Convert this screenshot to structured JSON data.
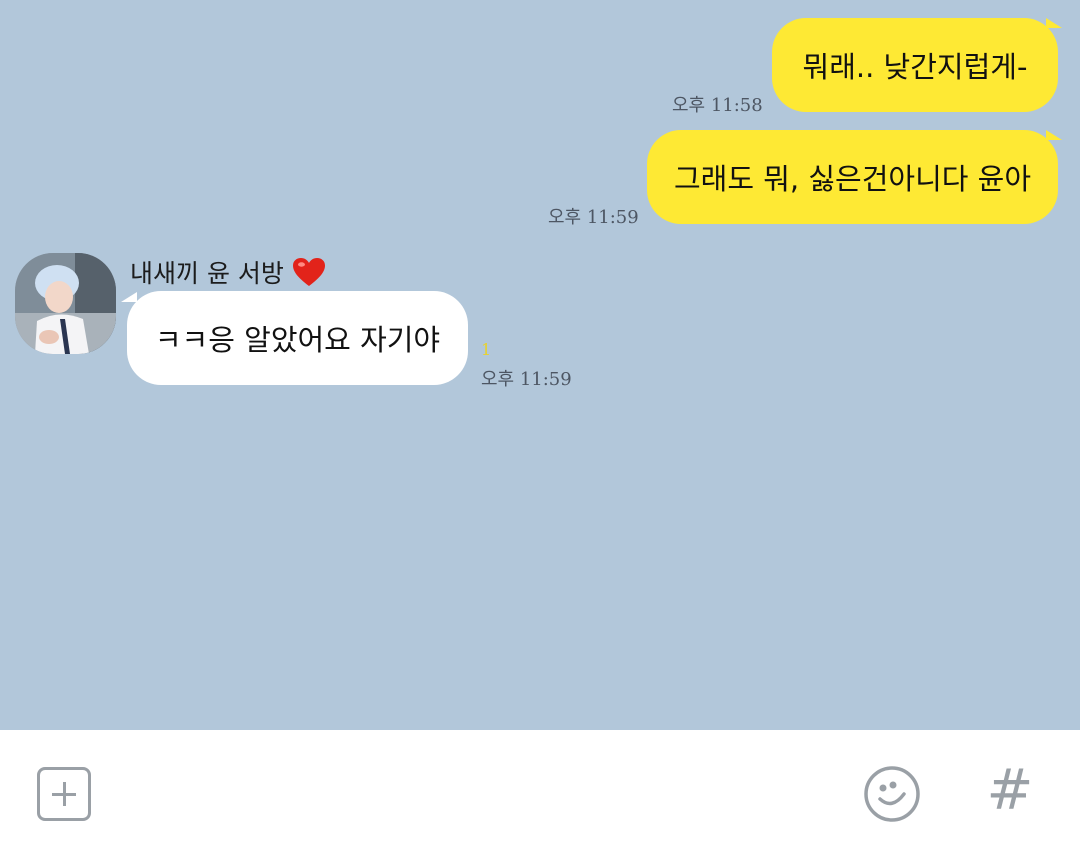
{
  "messages": [
    {
      "id": "m1",
      "direction": "out",
      "text": "뭐래.. 낮간지럽게-",
      "time": "오후 11:58"
    },
    {
      "id": "m2",
      "direction": "out",
      "text": "그래도 뭐, 싫은건아니다 윤아",
      "time": "오후 11:59"
    },
    {
      "id": "m3",
      "direction": "in",
      "sender": "내새끼 윤 서방",
      "sender_emoji": "❤️",
      "text": "ㅋㅋ응 알았어요 자기야",
      "unread": "1",
      "time": "오후 11:59"
    }
  ],
  "input_bar": {
    "plus_icon": "plus-square-icon",
    "emoji_icon": "smiley-icon",
    "hash_label": "#"
  },
  "colors": {
    "background": "#b2c7da",
    "outgoing_bubble": "#fee934",
    "incoming_bubble": "#ffffff",
    "unread_count": "#e8d22c"
  }
}
